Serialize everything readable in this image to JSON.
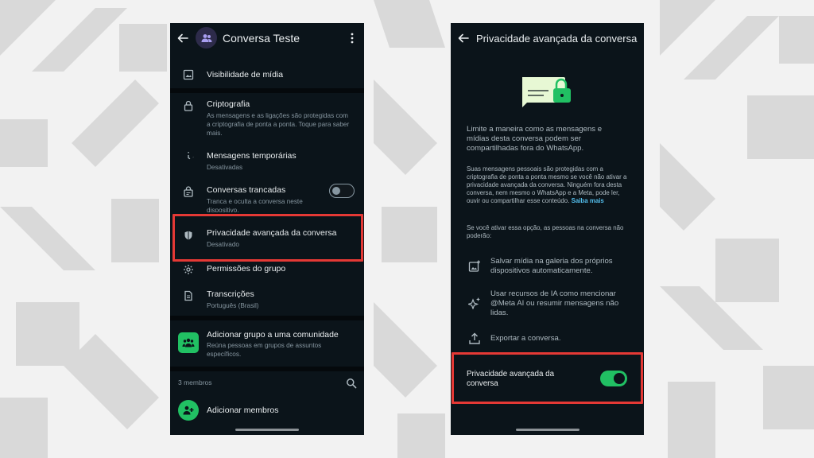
{
  "colors": {
    "accent": "#21c063",
    "highlight": "#e53935",
    "link": "#53bdeb",
    "screen_bg": "#0b141a"
  },
  "left_screen": {
    "header": {
      "title": "Conversa Teste",
      "back_icon": "arrow-left-icon",
      "menu_icon": "kebab-menu-icon",
      "avatar_icon": "group-avatar-icon"
    },
    "rows": [
      {
        "icon": "image-icon",
        "title": "Visibilidade de mídia",
        "subtitle": ""
      },
      {
        "icon": "lock-icon",
        "title": "Criptografia",
        "subtitle": "As mensagens e as ligações são protegidas com a criptografia de ponta a ponta. Toque para saber mais."
      },
      {
        "icon": "timer-icon",
        "title": "Mensagens temporárias",
        "subtitle": "Desativadas"
      },
      {
        "icon": "locked-chat-icon",
        "title": "Conversas trancadas",
        "subtitle": "Tranca e oculta a conversa neste dispositivo.",
        "toggle_on": false
      },
      {
        "icon": "shield-icon",
        "title": "Privacidade avançada da conversa",
        "subtitle": "Desativado"
      },
      {
        "icon": "gear-icon",
        "title": "Permissões do grupo",
        "subtitle": ""
      },
      {
        "icon": "transcript-icon",
        "title": "Transcrições",
        "subtitle": "Português (Brasil)"
      }
    ],
    "community": {
      "icon": "community-icon",
      "title": "Adicionar grupo a uma comunidade",
      "subtitle": "Reúna pessoas em grupos de assuntos específicos."
    },
    "members": {
      "count_label": "3 membros",
      "search_icon": "search-icon",
      "add_label": "Adicionar membros",
      "add_icon": "add-person-icon"
    }
  },
  "right_screen": {
    "header": {
      "title": "Privacidade avançada da conversa",
      "back_icon": "arrow-left-icon"
    },
    "illustration_icon": "locked-chat-bubble-icon",
    "lead": "Limite a maneira como as mensagens e mídias desta conversa podem ser compartilhadas fora do WhatsApp.",
    "body": "Suas mensagens pessoais são protegidas com a criptografia de ponta a ponta mesmo se você não ativar a privacidade avançada da conversa. Ninguém fora desta conversa, nem mesmo o WhatsApp e a Meta, pode ler, ouvir ou compartilhar esse conteúdo.",
    "link": "Saiba mais",
    "restrictions_intro": "Se você ativar essa opção, as pessoas na conversa não poderão:",
    "restrictions": [
      {
        "icon": "save-media-icon",
        "text": "Salvar mídia na galeria dos próprios dispositivos automaticamente."
      },
      {
        "icon": "ai-sparkle-icon",
        "text": "Usar recursos de IA como mencionar @Meta AI ou resumir mensagens não lidas."
      },
      {
        "icon": "export-icon",
        "text": "Exportar a conversa."
      }
    ],
    "toggle_label": "Privacidade avançada da conversa",
    "toggle_on": true
  }
}
